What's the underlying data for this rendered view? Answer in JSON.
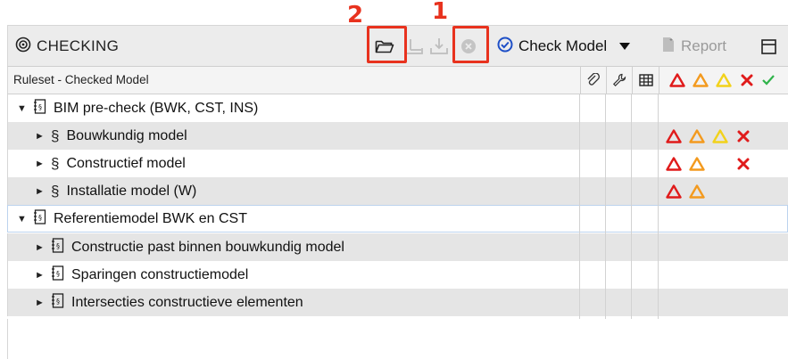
{
  "callouts": {
    "one": "1",
    "two": "2"
  },
  "toolbar": {
    "title": "CHECKING",
    "check_model_label": "Check Model",
    "report_label": "Report",
    "icons": [
      "target-icon",
      "folder-open-icon",
      "export-icon",
      "download-icon",
      "stop-icon",
      "check-badge-icon",
      "dropdown-arrow-icon",
      "report-icon",
      "panel-icon"
    ]
  },
  "table": {
    "header_label": "Ruleset - Checked Model",
    "header_icons": [
      "paperclip-icon",
      "wrench-icon",
      "grid-table-icon",
      "critical-icon",
      "moderate-icon",
      "minor-icon",
      "rejected-icon",
      "accepted-icon"
    ],
    "rows": [
      {
        "label": "BIM pre-check (BWK, CST, INS)",
        "level": 0,
        "expanded": true,
        "icon": "ruleset-icon",
        "statuses": []
      },
      {
        "label": "Bouwkundig model",
        "level": 1,
        "expanded": false,
        "icon": "section-icon",
        "statuses": [
          "critical",
          "moderate",
          "minor",
          "rejected"
        ]
      },
      {
        "label": "Constructief model",
        "level": 1,
        "expanded": false,
        "icon": "section-icon",
        "statuses": [
          "critical",
          "moderate",
          "rejected"
        ]
      },
      {
        "label": "Installatie model (W)",
        "level": 1,
        "expanded": false,
        "icon": "section-icon",
        "statuses": [
          "critical",
          "moderate"
        ]
      },
      {
        "label": "Referentiemodel BWK en CST",
        "level": 0,
        "expanded": true,
        "icon": "ruleset-icon",
        "statuses": []
      },
      {
        "label": "Constructie past binnen bouwkundig model",
        "level": 1,
        "expanded": false,
        "icon": "ruleset-icon",
        "statuses": []
      },
      {
        "label": "Sparingen constructiemodel",
        "level": 1,
        "expanded": false,
        "icon": "ruleset-icon",
        "statuses": []
      },
      {
        "label": "Intersecties constructieve elementen",
        "level": 1,
        "expanded": false,
        "icon": "ruleset-icon",
        "statuses": []
      }
    ]
  },
  "colors": {
    "annotation": "#e8321e",
    "critical": "#e01b1b",
    "moderate": "#f39a1e",
    "minor": "#f2d21b",
    "rejected": "#e01b1b",
    "accepted": "#2fb34a"
  }
}
